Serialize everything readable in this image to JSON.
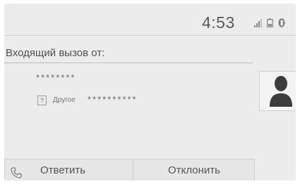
{
  "status": {
    "time": "4:53",
    "icons": [
      "signal-icon",
      "battery-icon",
      "bluetooth-icon"
    ]
  },
  "call": {
    "caption": "Входящий вызов от:",
    "caller_name": "********",
    "number_type": "Другое",
    "number_type_icon": "?",
    "number": "**********"
  },
  "actions": {
    "answer_label": "Ответить",
    "decline_label": "Отклонить"
  }
}
